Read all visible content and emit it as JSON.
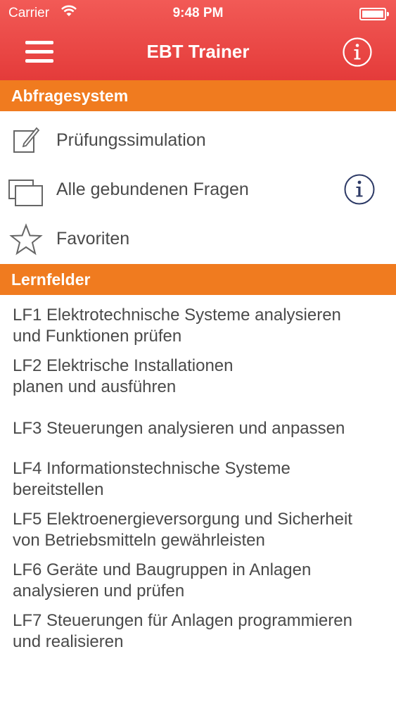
{
  "status_bar": {
    "carrier": "Carrier",
    "time": "9:48 PM"
  },
  "navbar": {
    "title": "EBT Trainer",
    "menu_icon": "hamburger-icon",
    "info_icon": "info-icon"
  },
  "sections": {
    "abfragesystem": {
      "title": "Abfragesystem",
      "items": [
        {
          "label": "Prüfungssimulation",
          "icon": "edit-icon"
        },
        {
          "label": "Alle gebundenen Fragen",
          "icon": "stack-icon"
        },
        {
          "label": "Favoriten",
          "icon": "star-icon"
        }
      ]
    },
    "lernfelder": {
      "title": "Lernfelder",
      "items": [
        {
          "line1": "LF1 Elektrotechnische Systeme analysieren",
          "line2": "und Funktionen prüfen"
        },
        {
          "line1": "LF2 Elektrische Installationen",
          "line2": "planen und ausführen"
        },
        {
          "line1": "LF3 Steuerungen analysieren und anpassen",
          "line2": ""
        },
        {
          "line1": "LF4 Informationstechnische Systeme",
          "line2": "bereitstellen"
        },
        {
          "line1": "LF5 Elektroenergieversorgung und Sicherheit",
          "line2": "von Betriebsmitteln gewährleisten"
        },
        {
          "line1": "LF6 Geräte und Baugruppen in Anlagen",
          "line2": "analysieren und prüfen"
        },
        {
          "line1": "LF7 Steuerungen für Anlagen programmieren",
          "line2": "und realisieren"
        }
      ]
    }
  },
  "colors": {
    "navbar": "#e8403d",
    "section_header": "#f07b1f",
    "text": "#4a4a4a",
    "info_icon": "#2d3a66"
  }
}
